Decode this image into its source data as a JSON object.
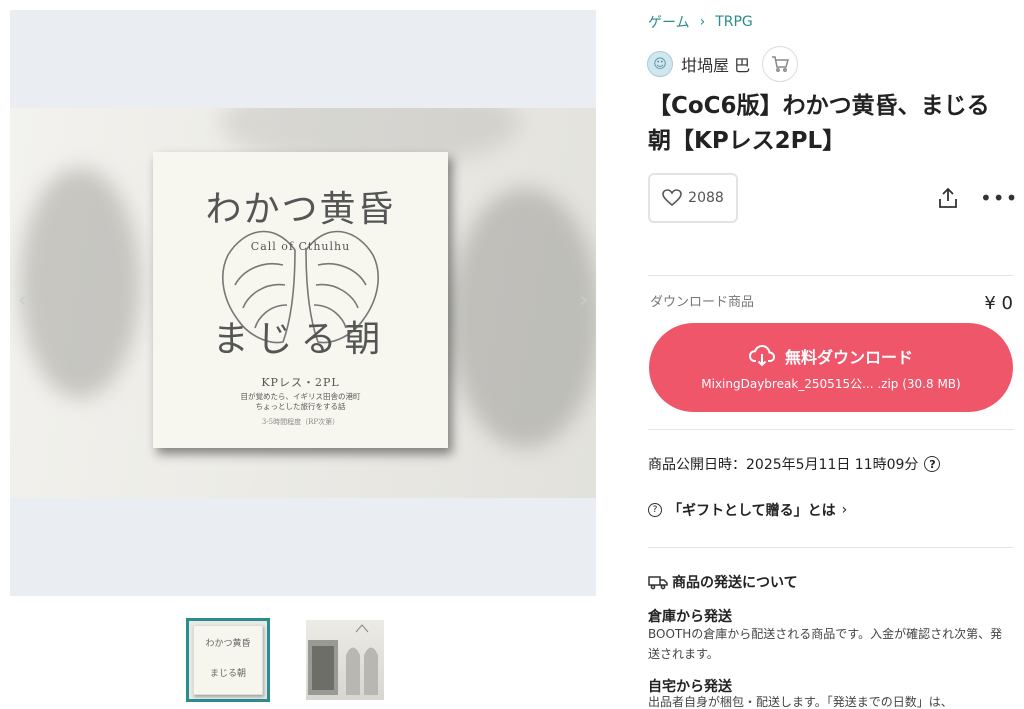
{
  "gallery": {
    "prev_arrow": "‹",
    "next_arrow": "›",
    "cover": {
      "title_top": "わかつ黄昏",
      "subtitle": "Call  of  Cthulhu",
      "title_bottom": "まじる朝",
      "kp_line": "KPレス・2PL",
      "desc_line1": "目が覚めたら、イギリス田舎の港町",
      "desc_line2": "ちょっとした旅行をする話",
      "time_line": "3-5時間程度（RP次第）"
    },
    "thumb1": {
      "top": "わかつ黄昏",
      "bottom": "まじる朝"
    }
  },
  "breadcrumb": {
    "items": [
      "ゲーム",
      "TRPG"
    ],
    "separator": "›"
  },
  "shop": {
    "name": "坩堝屋 巴"
  },
  "product": {
    "title": "【CoC6版】わかつ黄昏、まじる朝【KPレス2PL】",
    "likes": "2088",
    "download_label": "ダウンロード商品",
    "price": "¥ 0",
    "download_button": "無料ダウンロード",
    "file_name": "MixingDaybreak_250515公... .zip (30.8 MB)",
    "publish_date": "商品公開日時：2025年5月11日 11時09分",
    "gift_link": "「ギフトとして贈る」とは"
  },
  "shipping": {
    "heading": "商品の発送について",
    "warehouse_title": "倉庫から発送",
    "warehouse_text": "BOOTHの倉庫から配送される商品です。入金が確認され次第、発送されます。",
    "home_title": "自宅から発送",
    "home_text": "出品者自身が梱包・配送します。「発送までの日数」は、"
  },
  "colors": {
    "accent": "#2a8c8c",
    "download": "#f0566a"
  }
}
